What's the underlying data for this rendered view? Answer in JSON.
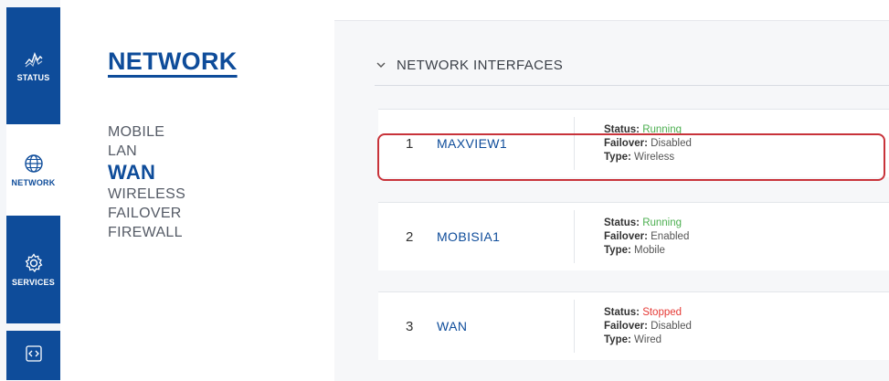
{
  "rail": {
    "status_label": "STATUS",
    "network_label": "NETWORK",
    "services_label": "SERVICES"
  },
  "menu": {
    "title": "NETWORK",
    "items": [
      "MOBILE",
      "LAN",
      "WAN",
      "WIRELESS",
      "FAILOVER",
      "FIREWALL"
    ],
    "active": "WAN"
  },
  "section": {
    "title": "NETWORK INTERFACES"
  },
  "interfaces": [
    {
      "index": "1",
      "name": "MAXVIEW1",
      "status_label": "Status:",
      "status": "Running",
      "failover_label": "Failover:",
      "failover": "Disabled",
      "type_label": "Type:",
      "type": "Wireless"
    },
    {
      "index": "2",
      "name": "MOBISIA1",
      "status_label": "Status:",
      "status": "Running",
      "failover_label": "Failover:",
      "failover": "Enabled",
      "type_label": "Type:",
      "type": "Mobile"
    },
    {
      "index": "3",
      "name": "WAN",
      "status_label": "Status:",
      "status": "Stopped",
      "failover_label": "Failover:",
      "failover": "Disabled",
      "type_label": "Type:",
      "type": "Wired"
    }
  ],
  "colors": {
    "brand": "#0e4c9a",
    "running": "#4caf50",
    "stopped": "#e53935",
    "highlight": "#c8333a"
  },
  "icons": [
    "pulse-icon",
    "globe-icon",
    "gear-icon",
    "code-icon",
    "chevron-down-icon"
  ]
}
